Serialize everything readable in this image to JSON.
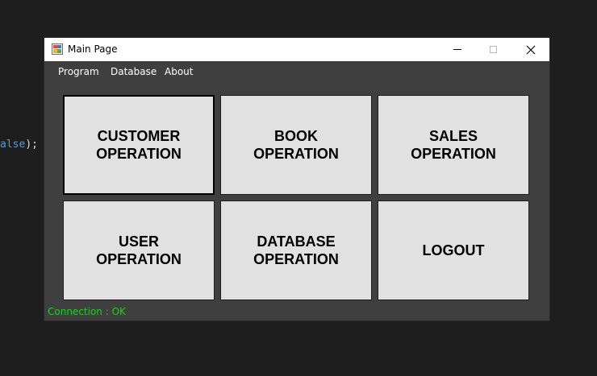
{
  "background_code": {
    "keyword": "alse",
    "rest": ");"
  },
  "window": {
    "title": "Main Page",
    "icon": "app-window-icon",
    "controls": {
      "minimize": "minimize-icon",
      "maximize": "maximize-icon",
      "close": "close-icon"
    }
  },
  "menu": {
    "items": [
      {
        "label": "Program"
      },
      {
        "label": "Database"
      },
      {
        "label": "About"
      }
    ]
  },
  "operations": [
    {
      "label": "CUSTOMER\nOPERATION",
      "focused": true
    },
    {
      "label": "BOOK\nOPERATION"
    },
    {
      "label": "SALES\nOPERATION"
    },
    {
      "label": "USER\nOPERATION"
    },
    {
      "label": "DATABASE\nOPERATION"
    },
    {
      "label": "LOGOUT"
    }
  ],
  "status": {
    "text": "Connection : OK",
    "color": "#22cc22"
  },
  "colors": {
    "window_bg": "#3f3f3f",
    "button_bg": "#e1e1e1",
    "desktop_bg": "#1e1e1e"
  }
}
